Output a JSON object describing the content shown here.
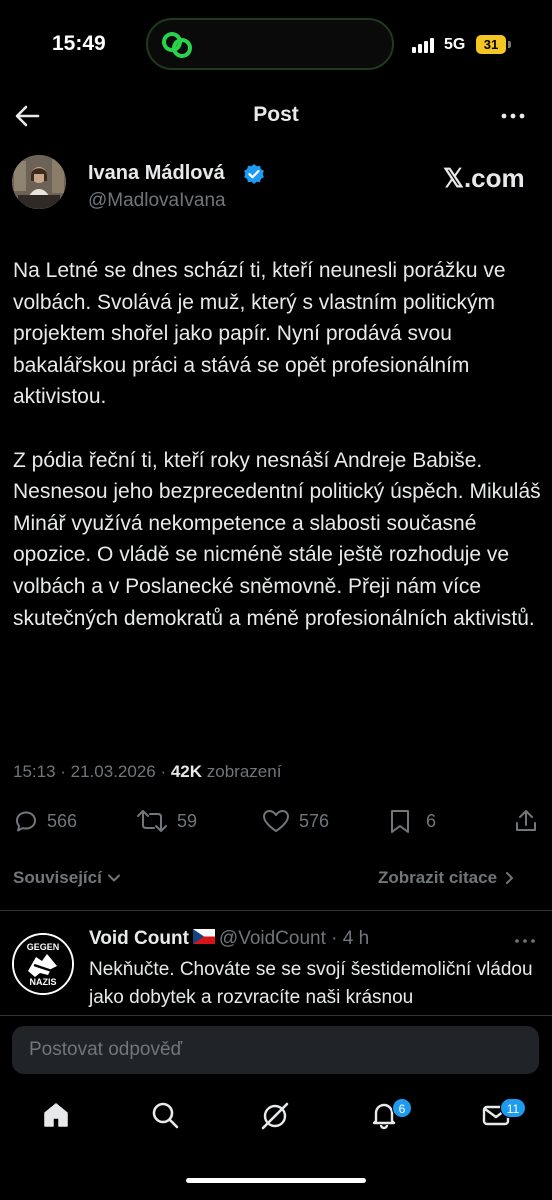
{
  "status_bar": {
    "time": "15:49",
    "network": "5G",
    "battery": "31"
  },
  "header": {
    "title": "Post"
  },
  "author": {
    "name": "Ivana Mádlová",
    "handle": "@MadlovaIvana"
  },
  "watermark": "𝕏.com",
  "post": {
    "paragraphs": [
      "Na Letné se dnes schází ti, kteří neunesli porážku ve volbách. Svolává je muž, který s vlastním politickým projektem shořel jako papír. Nyní prodává svou bakalářskou práci a stává se opět profesionálním aktivistou.",
      "Z pódia řeční ti, kteří roky nesnáší Andreje Babiše. Nesnesou jeho bezprecedentní politický úspěch. Mikuláš Minář využívá nekompetence a slabosti současné opozice. O vládě se nicméně stále ještě rozhoduje ve volbách a v Poslanecké sněmovně. Přeji nám více skutečných demokratů a méně profesionálních aktivistů."
    ],
    "timestamp": "15:13 · 21.03.2026 · ",
    "views_count": "42K",
    "views_label": " zobrazení"
  },
  "actions": {
    "replies": "566",
    "reposts": "59",
    "likes": "576",
    "bookmarks": "6"
  },
  "tabs": {
    "related": "Související",
    "quotes": "Zobrazit citace"
  },
  "reply": {
    "name": "Void Count",
    "flag": "🇨🇿",
    "handle": "@VoidCount · 4 h",
    "text": "Nekňučte. Chováte se se svojí šestidemoliční vládou jako dobytek a rozvracíte naši krásnou",
    "avatar_text_top": "GEGEN",
    "avatar_text_bottom": "NAZIS"
  },
  "compose": {
    "placeholder": "Postovat odpověď"
  },
  "nav": {
    "notifications_badge": "6",
    "messages_badge": "11"
  },
  "colors": {
    "accent": "#1d9bf0",
    "muted": "#71767b",
    "text": "#e7e9ea",
    "background": "#000000"
  }
}
